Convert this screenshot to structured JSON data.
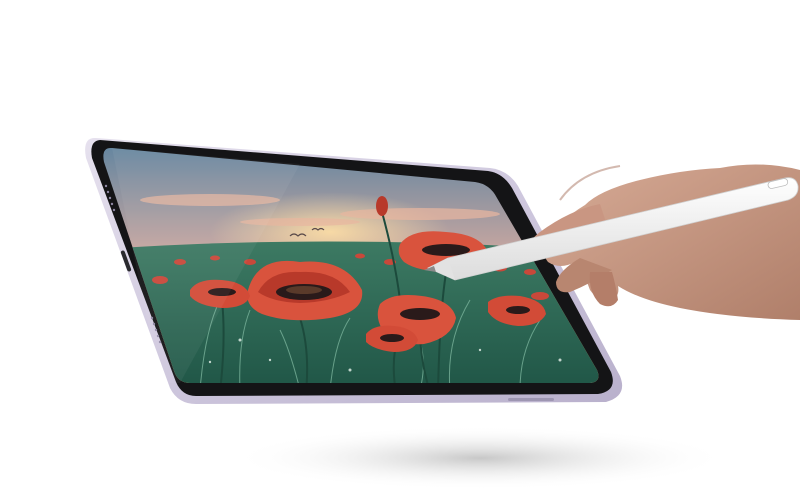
{
  "scene": {
    "subject": "tablet-with-stylus",
    "colors": {
      "background": "#ffffff",
      "tablet_frame": "#cfc8de",
      "tablet_bezel": "#141416",
      "sky_top": "#6f8fa6",
      "sky_horizon": "#f2a36a",
      "field": "#2f6b5a",
      "poppy": "#d9533d",
      "poppy_center": "#2a1a1a",
      "stylus": "#f4f4f4",
      "skin": "#c79a86"
    },
    "icons": {
      "tablet": "tablet-icon",
      "stylus": "stylus-icon",
      "hand": "hand-icon",
      "poppy": "poppy-icon"
    }
  }
}
